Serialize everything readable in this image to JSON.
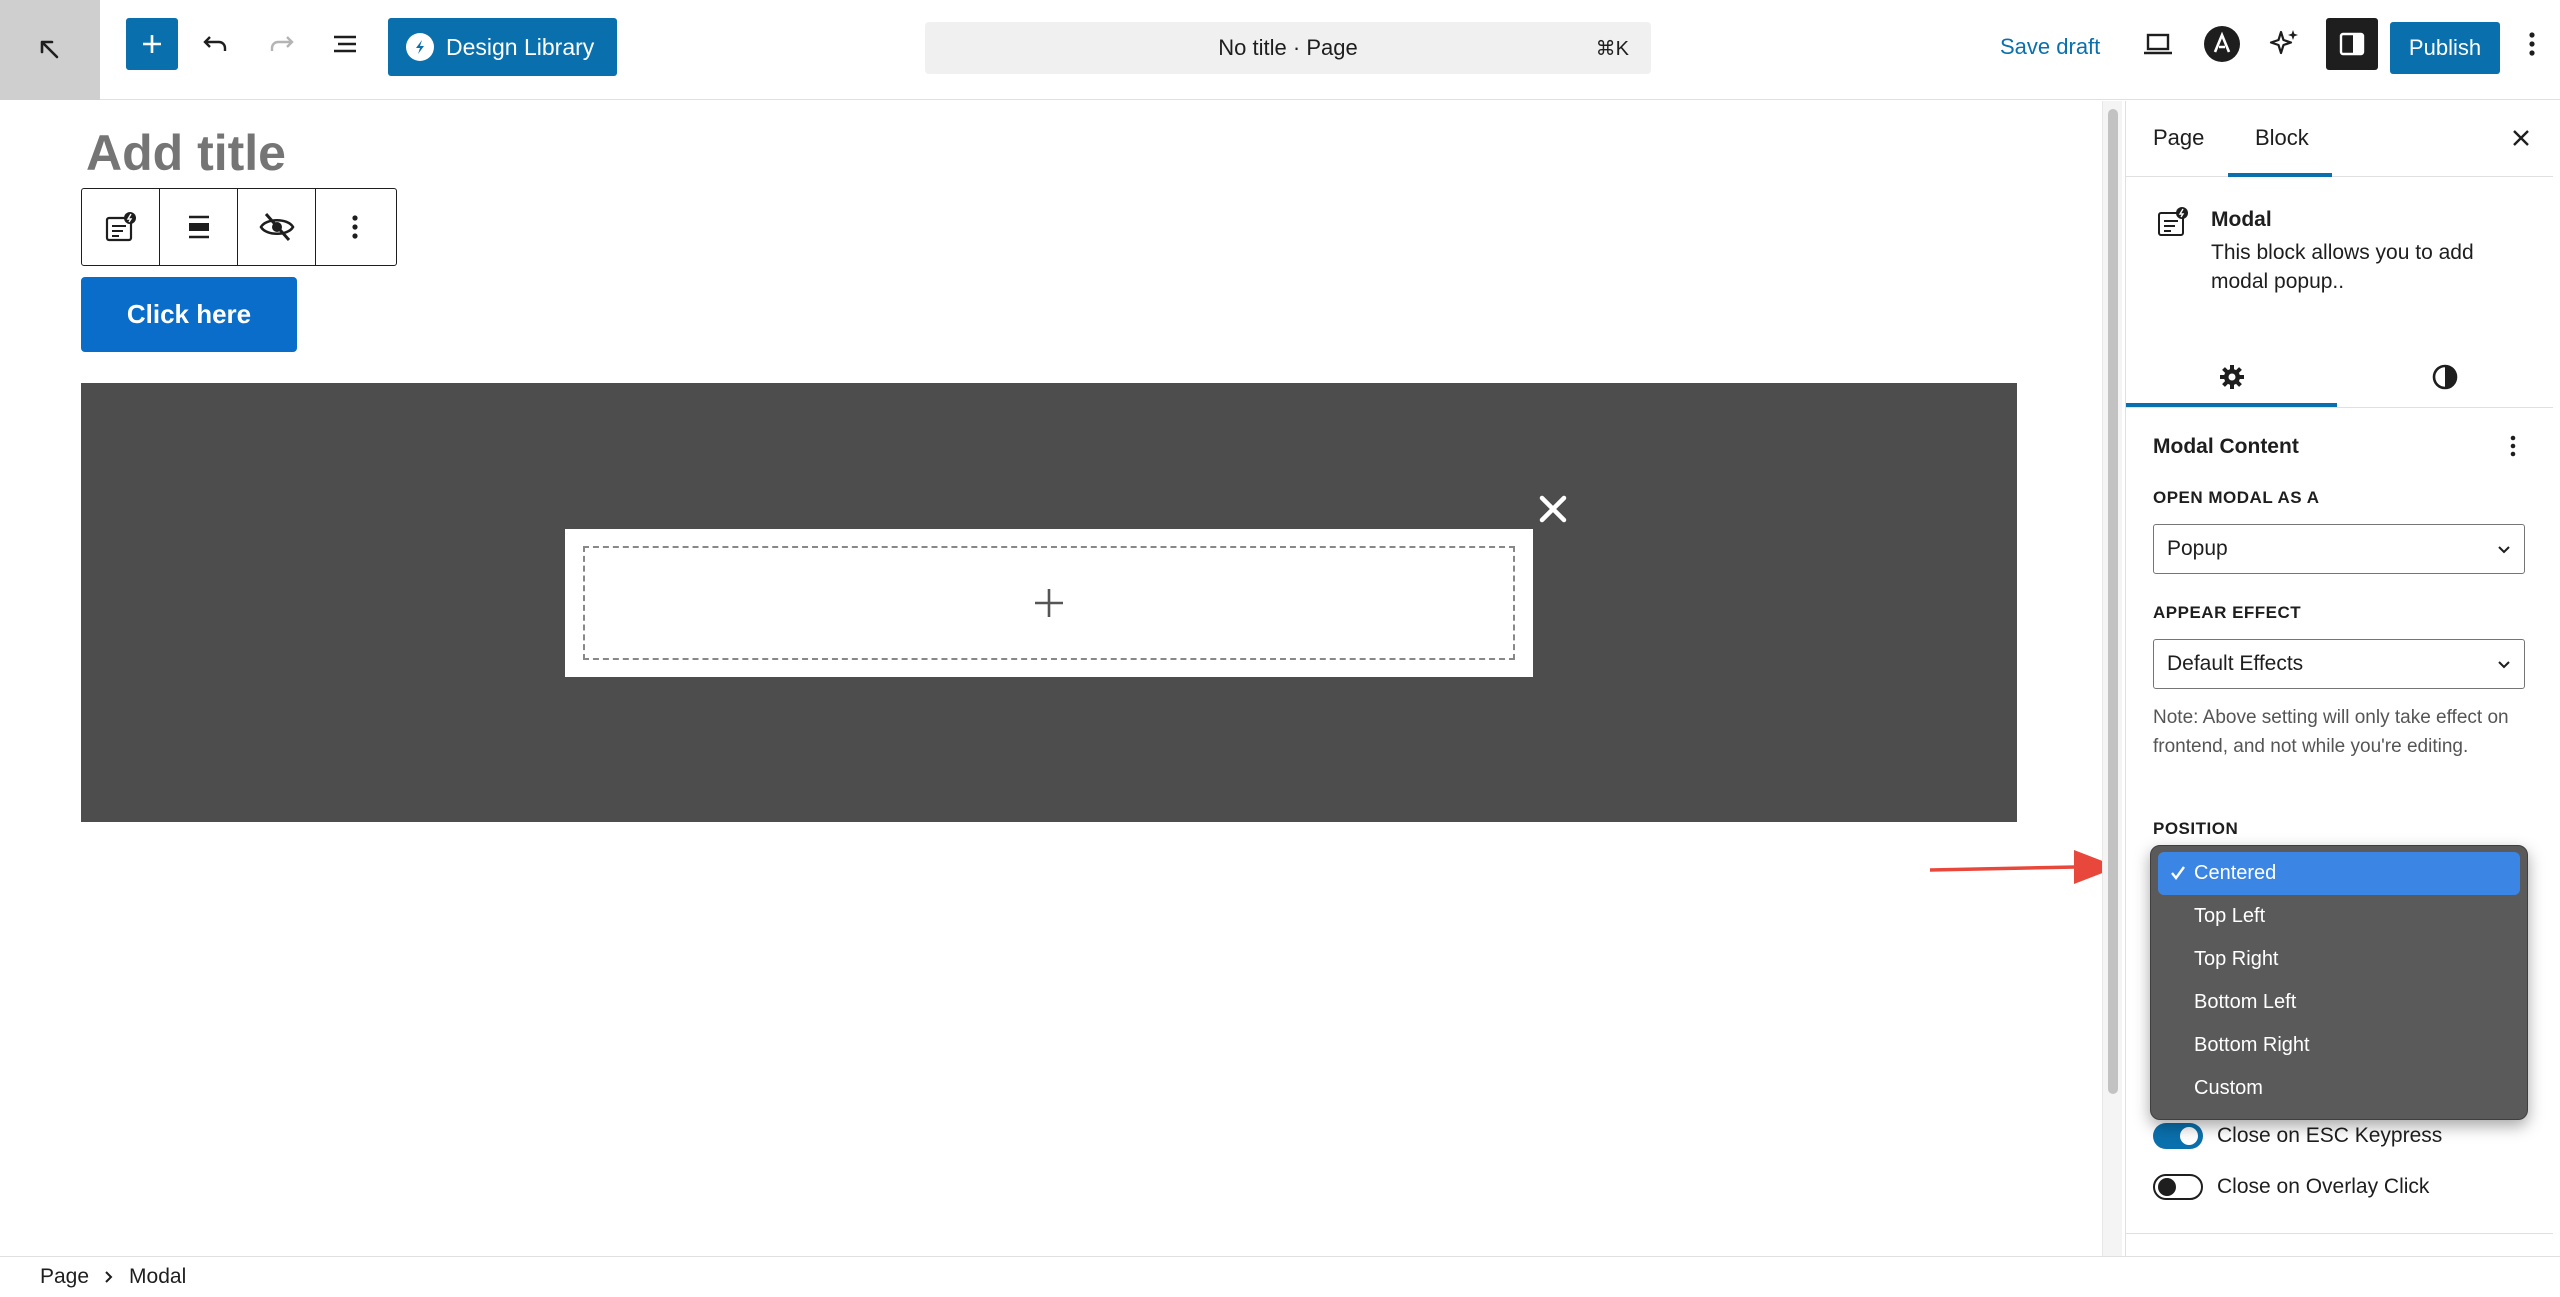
{
  "topbar": {
    "design_library_label": "Design Library",
    "command_bar_title": "No title · Page",
    "command_shortcut": "⌘K",
    "save_draft_label": "Save draft",
    "publish_label": "Publish"
  },
  "canvas": {
    "title_placeholder": "Add title",
    "button_label": "Click here"
  },
  "sidebar": {
    "tabs": [
      {
        "label": "Page"
      },
      {
        "label": "Block"
      }
    ],
    "block": {
      "name": "Modal",
      "description": "This block allows you to add modal popup.."
    },
    "panel_title": "Modal Content",
    "open_modal_label": "OPEN MODAL AS A",
    "open_modal_value": "Popup",
    "appear_effect_label": "APPEAR EFFECT",
    "appear_effect_value": "Default Effects",
    "note": "Note: Above setting will only take effect on frontend, and not while you're editing.",
    "position_label": "POSITION",
    "toggles": [
      {
        "label": "Close on ESC Keypress",
        "on": true
      },
      {
        "label": "Close on Overlay Click",
        "on": false
      }
    ]
  },
  "position_dropdown": {
    "options": [
      "Centered",
      "Top Left",
      "Top Right",
      "Bottom Left",
      "Bottom Right",
      "Custom"
    ],
    "selected": "Centered"
  },
  "breadcrumb": {
    "items": [
      "Page",
      "Modal"
    ]
  },
  "colors": {
    "accent": "#0a70ad",
    "overlay": "#4d4d4d",
    "dropdown_bg": "#5a5a5a",
    "dropdown_selected": "#3b86e5",
    "annotation_arrow": "#e8473c"
  }
}
